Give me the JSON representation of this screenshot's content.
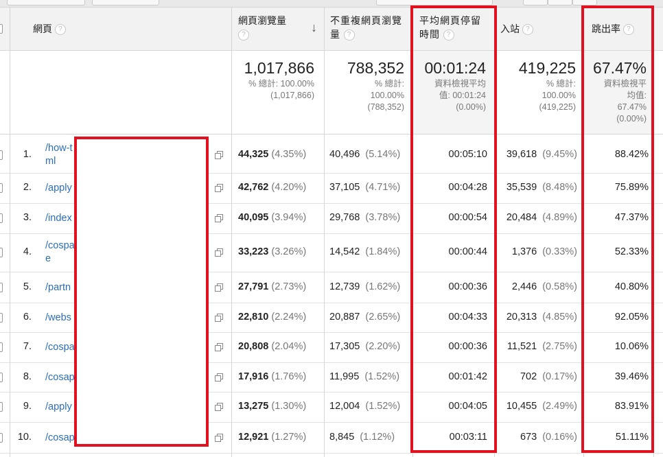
{
  "columns": {
    "page": "網頁",
    "pageviews_line1": "網頁瀏覽量",
    "unique_line1": "不重複網頁瀏覽",
    "unique_line2": "量",
    "avg_time_line1": "平均網頁停留",
    "avg_time_line2": "時間",
    "entrances": "入站",
    "bounce_rate": "跳出率",
    "help_glyph": "?",
    "sort_glyph": "↓"
  },
  "totals": {
    "pageviews": {
      "value": "1,017,866",
      "line1": "% 總計: 100.00%",
      "line2": "(1,017,866)"
    },
    "unique": {
      "value": "788,352",
      "line1": "% 總計:",
      "line2": "100.00%",
      "line3": "(788,352)"
    },
    "avg_time": {
      "value": "00:01:24",
      "line1": "資料檢視平均",
      "line2": "值: 00:01:24",
      "line3": "(0.00%)"
    },
    "entrances": {
      "value": "419,225",
      "line1": "% 總計:",
      "line2": "100.00%",
      "line3": "(419,225)"
    },
    "bounce": {
      "value": "67.47%",
      "line1": "資料檢視平",
      "line2": "均值:",
      "line3": "67.47%",
      "line4": "(0.00%)"
    }
  },
  "rows": [
    {
      "n": "1.",
      "path": "/how-t",
      "path2": "ml",
      "pv": "44,325",
      "pv_pct": "(4.35%)",
      "uv": "40,496",
      "uv_pct": "(5.14%)",
      "time": "00:05:10",
      "ent": "39,618",
      "ent_pct": "(9.45%)",
      "bounce": "88.42%"
    },
    {
      "n": "2.",
      "path": "/apply",
      "path2": "",
      "pv": "42,762",
      "pv_pct": "(4.20%)",
      "uv": "37,105",
      "uv_pct": "(4.71%)",
      "time": "00:04:28",
      "ent": "35,539",
      "ent_pct": "(8.48%)",
      "bounce": "75.89%"
    },
    {
      "n": "3.",
      "path": "/index",
      "path2": "",
      "pv": "40,095",
      "pv_pct": "(3.94%)",
      "uv": "29,768",
      "uv_pct": "(3.78%)",
      "time": "00:00:54",
      "ent": "20,484",
      "ent_pct": "(4.89%)",
      "bounce": "47.37%"
    },
    {
      "n": "4.",
      "path": "/cospa",
      "path2": "e",
      "pv": "33,223",
      "pv_pct": "(3.26%)",
      "uv": "14,542",
      "uv_pct": "(1.84%)",
      "time": "00:00:44",
      "ent": "1,376",
      "ent_pct": "(0.33%)",
      "bounce": "52.33%"
    },
    {
      "n": "5.",
      "path": "/partn",
      "path2": "",
      "pv": "27,791",
      "pv_pct": "(2.73%)",
      "uv": "12,739",
      "uv_pct": "(1.62%)",
      "time": "00:00:36",
      "ent": "2,446",
      "ent_pct": "(0.58%)",
      "bounce": "40.80%"
    },
    {
      "n": "6.",
      "path": "/webs",
      "path2": "",
      "pv": "22,810",
      "pv_pct": "(2.24%)",
      "uv": "20,887",
      "uv_pct": "(2.65%)",
      "time": "00:04:33",
      "ent": "20,313",
      "ent_pct": "(4.85%)",
      "bounce": "92.05%"
    },
    {
      "n": "7.",
      "path": "/cospa",
      "path2": "",
      "pv": "20,808",
      "pv_pct": "(2.04%)",
      "uv": "17,305",
      "uv_pct": "(2.20%)",
      "time": "00:00:36",
      "ent": "11,521",
      "ent_pct": "(2.75%)",
      "bounce": "10.06%"
    },
    {
      "n": "8.",
      "path": "/cosap",
      "path2": "",
      "pv": "17,916",
      "pv_pct": "(1.76%)",
      "uv": "11,995",
      "uv_pct": "(1.52%)",
      "time": "00:01:42",
      "ent": "702",
      "ent_pct": "(0.17%)",
      "bounce": "39.46%"
    },
    {
      "n": "9.",
      "path": "/apply",
      "path2": "",
      "pv": "13,275",
      "pv_pct": "(1.30%)",
      "uv": "12,004",
      "uv_pct": "(1.52%)",
      "time": "00:04:05",
      "ent": "10,455",
      "ent_pct": "(2.49%)",
      "bounce": "83.91%"
    },
    {
      "n": "10.",
      "path": "/cosap",
      "path2": "",
      "pv": "12,921",
      "pv_pct": "(1.27%)",
      "uv": "8,845",
      "uv_pct": "(1.12%)",
      "time": "00:03:11",
      "ent": "673",
      "ent_pct": "(0.16%)",
      "bounce": "51.11%"
    }
  ]
}
